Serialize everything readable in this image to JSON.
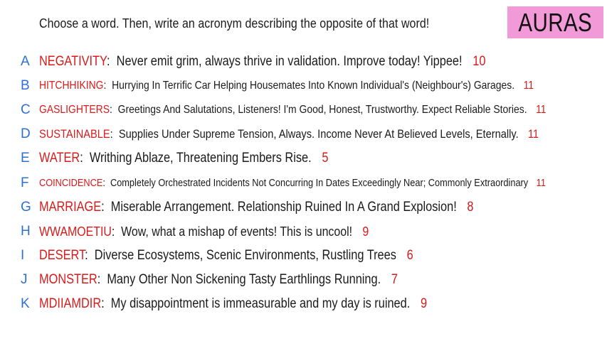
{
  "header": {
    "prompt": "Choose a word. Then, write an acronym describing the opposite of that word!",
    "logo": "AURAS"
  },
  "colors": {
    "letter": "#2f6fd0",
    "word": "#d91a1a",
    "count": "#d91a1a",
    "logo_bg": "#f29ad8"
  },
  "entries": [
    {
      "letter": "A",
      "word": "NEGATIVITY",
      "description": "Never emit grim, always thrive in validation. Improve today! Yippee!",
      "count": "10"
    },
    {
      "letter": "B",
      "word": "HITCHHIKING",
      "description": "Hurrying In Terrific Car Helping Housemates Into Known Individual's (Neighbour's) Garages.",
      "count": "11"
    },
    {
      "letter": "C",
      "word": "GASLIGHTERS",
      "description": "Greetings And Salutations, Listeners! I'm Good, Honest, Trustworthy. Expect Reliable Stories.",
      "count": "11"
    },
    {
      "letter": "D",
      "word": "SUSTAINABLE",
      "description": "Supplies Under Supreme Tension, Always. Income Never At Believed Levels, Eternally.",
      "count": "11"
    },
    {
      "letter": "E",
      "word": "WATER",
      "description": "Writhing Ablaze, Threatening Embers Rise.",
      "count": "5"
    },
    {
      "letter": "F",
      "word": "COINCIDENCE",
      "description": "Completely Orchestrated Incidents Not Concurring In Dates Exceedingly Near; Commonly Extraordinary",
      "count": "11"
    },
    {
      "letter": "G",
      "word": "MARRIAGE",
      "description": "Miserable Arrangement. Relationship Ruined In A Grand Explosion!",
      "count": "8"
    },
    {
      "letter": "H",
      "word": "WWAMOETIU",
      "description": "Wow, what a mishap of events! This is uncool!",
      "count": "9"
    },
    {
      "letter": "I",
      "word": "DESERT",
      "description": "Diverse Ecosystems, Scenic Environments, Rustling Trees",
      "count": "6"
    },
    {
      "letter": "J",
      "word": "MONSTER",
      "description": "Many Other Non Sickening Tasty Earthlings Running.",
      "count": "7"
    },
    {
      "letter": "K",
      "word": "MDIIAMDIR",
      "description": "My disappointment is immeasurable and my day is ruined.",
      "count": "9"
    }
  ]
}
